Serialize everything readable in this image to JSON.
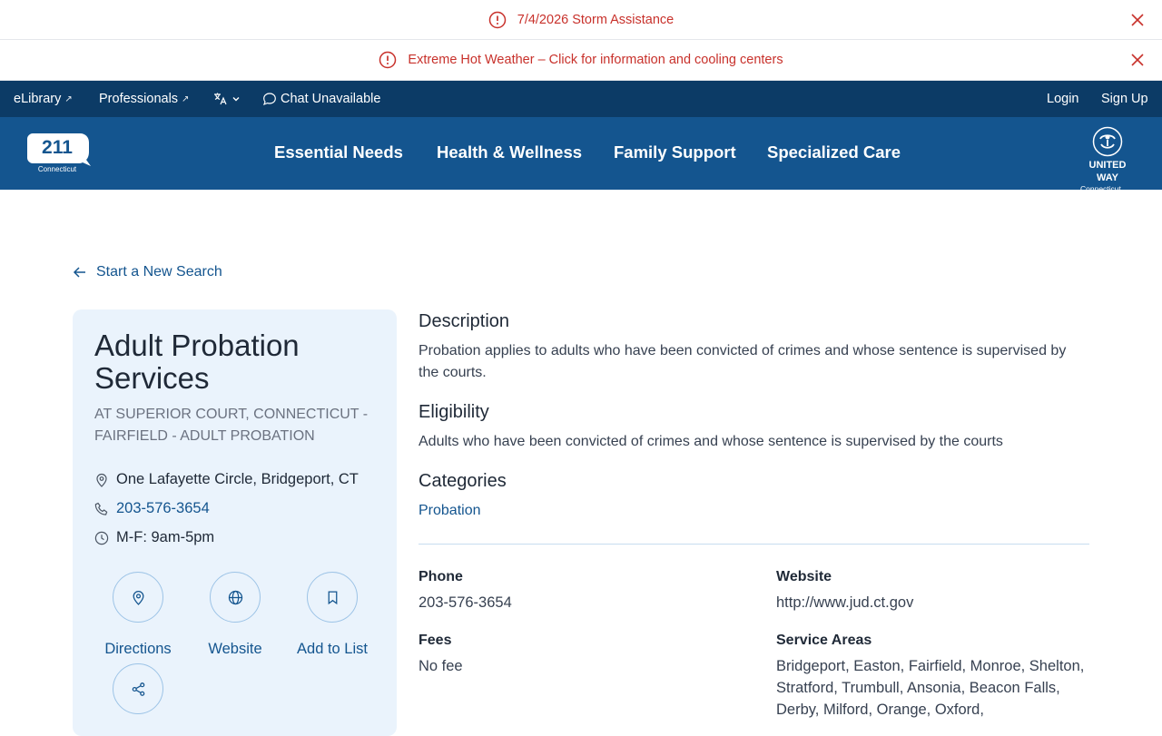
{
  "alerts": [
    {
      "text": "7/4/2026 Storm Assistance",
      "icon": "info-circle-icon"
    },
    {
      "text": "Extreme Hot Weather – Click for information and cooling centers",
      "icon": "info-circle-icon"
    }
  ],
  "utility_nav": {
    "elibrary": "eLibrary",
    "professionals": "Professionals",
    "chat": "Chat Unavailable",
    "login": "Login",
    "signup": "Sign Up"
  },
  "brand": {
    "logo_number": "211",
    "logo_state": "Connecticut",
    "partner_line1": "UNITED WAY",
    "partner_line2": "Connecticut"
  },
  "main_nav": [
    "Essential Needs",
    "Health & Wellness",
    "Family Support",
    "Specialized Care"
  ],
  "back_link": "Start a New Search",
  "service": {
    "title": "Adult Probation Services",
    "org": "at SUPERIOR COURT, CONNECTICUT - FAIRFIELD - ADULT PROBATION",
    "address": "One Lafayette Circle, Bridgeport, CT",
    "phone": "203-576-3654",
    "hours": "M-F: 9am-5pm"
  },
  "actions": {
    "directions": "Directions",
    "website": "Website",
    "add_to_list": "Add to List"
  },
  "details": {
    "description_title": "Description",
    "description": "Probation applies to adults who have been convicted of crimes and whose sentence is supervised by the courts.",
    "eligibility_title": "Eligibility",
    "eligibility": "Adults who have been convicted of crimes and whose sentence is supervised by the courts",
    "categories_title": "Categories",
    "category": "Probation",
    "phone_label": "Phone",
    "phone": "203-576-3654",
    "website_label": "Website",
    "website": "http://www.jud.ct.gov",
    "fees_label": "Fees",
    "fees": "No fee",
    "service_areas_label": "Service Areas",
    "service_areas": "Bridgeport, Easton, Fairfield, Monroe, Shelton, Stratford, Trumbull, Ansonia, Beacon Falls, Derby, Milford, Orange, Oxford,"
  },
  "colors": {
    "alert": "#c8312b",
    "utility_bg": "#0c3b66",
    "nav_bg": "#14558f",
    "card_bg": "#eaf3fc",
    "link": "#14558f"
  }
}
